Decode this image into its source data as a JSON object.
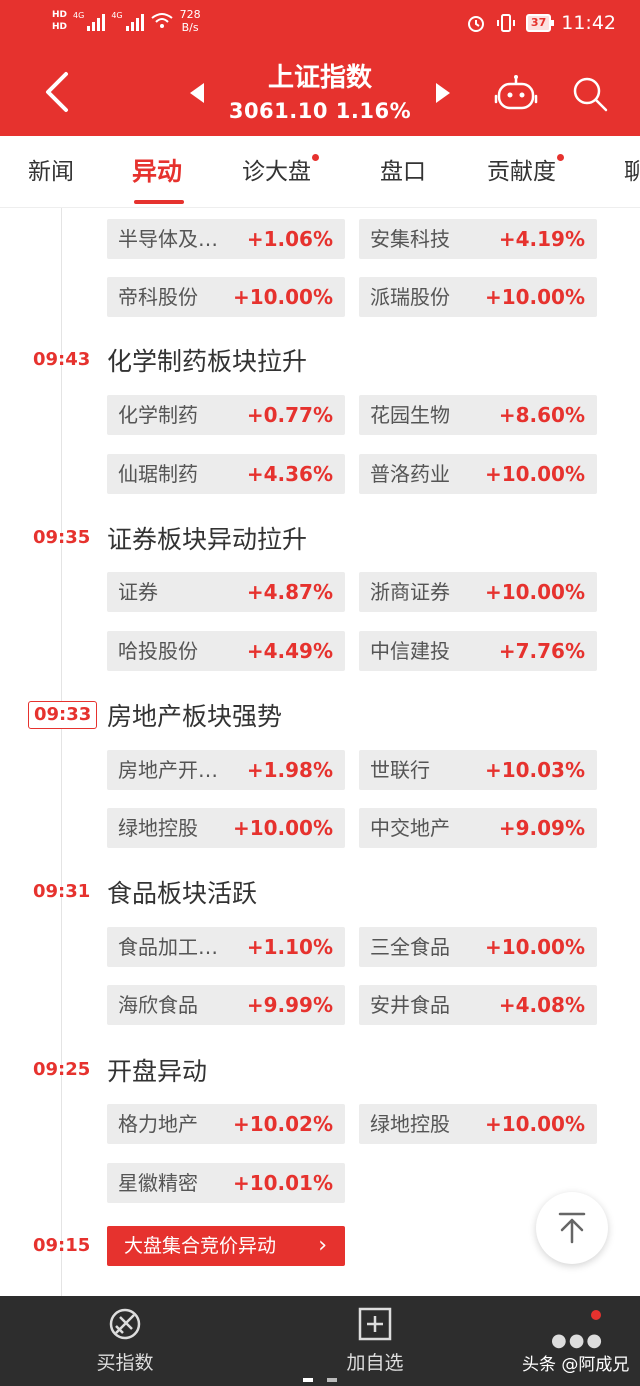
{
  "status_bar": {
    "hd_top": "HD",
    "hd_bottom": "HD",
    "signal1": "4G",
    "signal2": "4G",
    "speed_value": "728",
    "speed_unit": "B/s",
    "battery": "37",
    "time": "11:42"
  },
  "header": {
    "title": "上证指数",
    "subtitle": "3061.10  1.16%"
  },
  "tabs": [
    {
      "label": "新闻"
    },
    {
      "label": "异动"
    },
    {
      "label": "诊大盘"
    },
    {
      "label": "盘口"
    },
    {
      "label": "贡献度"
    },
    {
      "label": "聊"
    }
  ],
  "events": [
    {
      "time": "",
      "title": "",
      "stocks": [
        {
          "name": "半导体及…",
          "change": "+1.06%"
        },
        {
          "name": "安集科技",
          "change": "+4.19%"
        },
        {
          "name": "帝科股份",
          "change": "+10.00%"
        },
        {
          "name": "派瑞股份",
          "change": "+10.00%"
        }
      ]
    },
    {
      "time": "09:43",
      "title": "化学制药板块拉升",
      "stocks": [
        {
          "name": "化学制药",
          "change": "+0.77%"
        },
        {
          "name": "花园生物",
          "change": "+8.60%"
        },
        {
          "name": "仙琚制药",
          "change": "+4.36%"
        },
        {
          "name": "普洛药业",
          "change": "+10.00%"
        }
      ]
    },
    {
      "time": "09:35",
      "title": "证券板块异动拉升",
      "stocks": [
        {
          "name": "证券",
          "change": "+4.87%"
        },
        {
          "name": "浙商证券",
          "change": "+10.00%"
        },
        {
          "name": "哈投股份",
          "change": "+4.49%"
        },
        {
          "name": "中信建投",
          "change": "+7.76%"
        }
      ]
    },
    {
      "time": "09:33",
      "title": "房地产板块强势",
      "stocks": [
        {
          "name": "房地产开…",
          "change": "+1.98%"
        },
        {
          "name": "世联行",
          "change": "+10.03%"
        },
        {
          "name": "绿地控股",
          "change": "+10.00%"
        },
        {
          "name": "中交地产",
          "change": "+9.09%"
        }
      ]
    },
    {
      "time": "09:31",
      "title": "食品板块活跃",
      "stocks": [
        {
          "name": "食品加工…",
          "change": "+1.10%"
        },
        {
          "name": "三全食品",
          "change": "+10.00%"
        },
        {
          "name": "海欣食品",
          "change": "+9.99%"
        },
        {
          "name": "安井食品",
          "change": "+4.08%"
        }
      ]
    },
    {
      "time": "09:25",
      "title": "开盘异动",
      "stocks": [
        {
          "name": "格力地产",
          "change": "+10.02%"
        },
        {
          "name": "绿地控股",
          "change": "+10.00%"
        },
        {
          "name": "星徽精密",
          "change": "+10.01%"
        }
      ]
    },
    {
      "time": "09:15",
      "title": "",
      "stocks": []
    }
  ],
  "auction_button": "大盘集合竞价异动",
  "bottom_bar": {
    "buy_index": "买指数",
    "add_watchlist": "加自选"
  },
  "watermark": "头条 @阿成兄",
  "colors": {
    "accent": "#e6322e",
    "chip_bg": "#ececec",
    "bottom_bg": "#2d2d2d"
  }
}
